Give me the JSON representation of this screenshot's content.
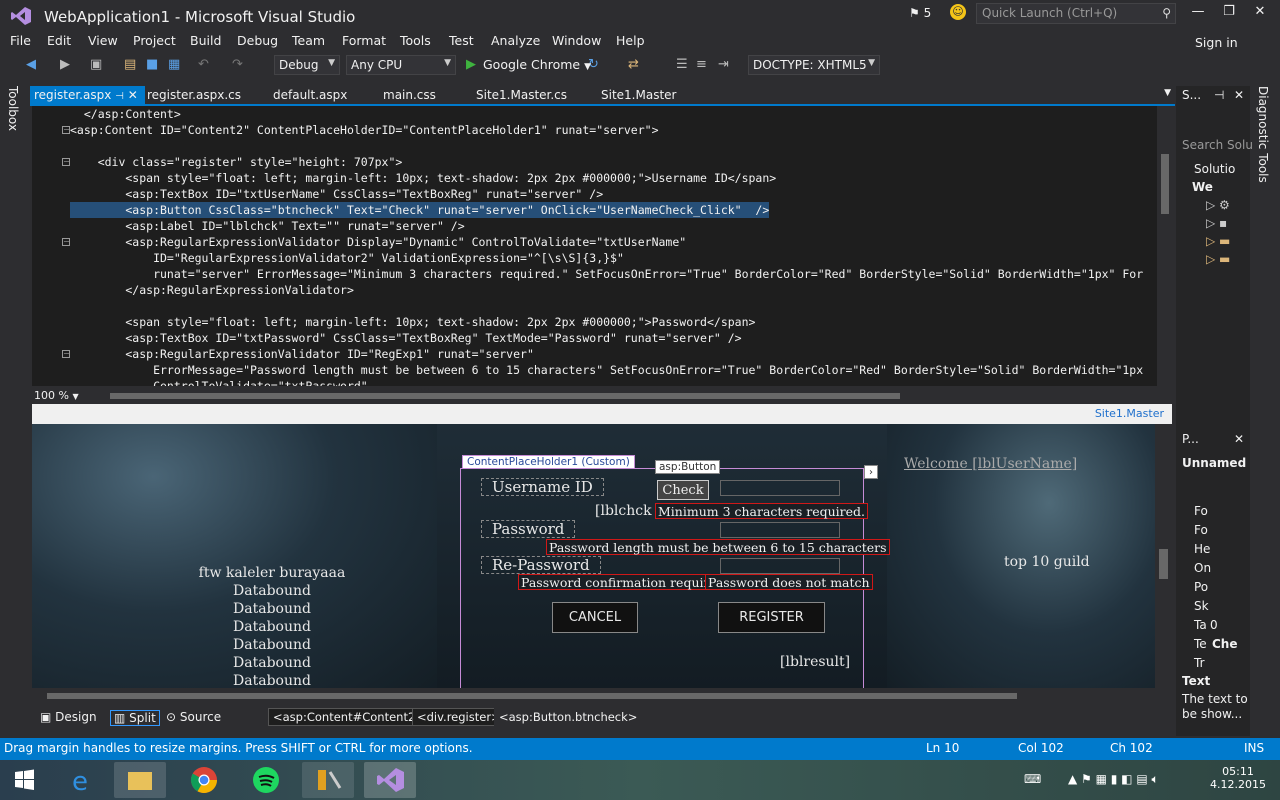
{
  "window": {
    "title": "WebApplication1 - Microsoft Visual Studio",
    "notifications": "5",
    "quick_launch_placeholder": "Quick Launch (Ctrl+Q)",
    "sign_in": "Sign in"
  },
  "menu": [
    "File",
    "Edit",
    "View",
    "Project",
    "Build",
    "Debug",
    "Team",
    "Format",
    "Tools",
    "Test",
    "Analyze",
    "Window",
    "Help"
  ],
  "toolbar": {
    "config": "Debug",
    "platform": "Any CPU",
    "browser": "Google Chrome",
    "doctype": "DOCTYPE: XHTML5"
  },
  "left_strip": "Toolbox",
  "right_strip": "Diagnostic Tools",
  "tabs": [
    "register.aspx",
    "register.aspx.cs",
    "default.aspx",
    "main.css",
    "Site1.Master.cs",
    "Site1.Master"
  ],
  "code": [
    "  </asp:Content>",
    "<asp:Content ID=\"Content2\" ContentPlaceHolderID=\"ContentPlaceHolder1\" runat=\"server\">",
    "",
    "    <div class=\"register\" style=\"height: 707px\">",
    "        <span style=\"float: left; margin-left: 10px; text-shadow: 2px 2px #000000;\">Username ID</span>",
    "        <asp:TextBox ID=\"txtUserName\" CssClass=\"TextBoxReg\" runat=\"server\" />",
    "        <asp:Button CssClass=\"btncheck\" Text=\"Check\" runat=\"server\" OnClick=\"UserNameCheck_Click\"  />",
    "        <asp:Label ID=\"lblchck\" Text=\"\" runat=\"server\" />",
    "        <asp:RegularExpressionValidator Display=\"Dynamic\" ControlToValidate=\"txtUserName\"",
    "            ID=\"RegularExpressionValidator2\" ValidationExpression=\"^[\\s\\S]{3,}$\"",
    "            runat=\"server\" ErrorMessage=\"Minimum 3 characters required.\" SetFocusOnError=\"True\" BorderColor=\"Red\" BorderStyle=\"Solid\" BorderWidth=\"1px\" For",
    "        </asp:RegularExpressionValidator>",
    "",
    "        <span style=\"float: left; margin-left: 10px; text-shadow: 2px 2px #000000;\">Password</span>",
    "        <asp:TextBox ID=\"txtPassword\" CssClass=\"TextBoxReg\" TextMode=\"Password\" runat=\"server\" />",
    "        <asp:RegularExpressionValidator ID=\"RegExp1\" runat=\"server\"",
    "            ErrorMessage=\"Password length must be between 6 to 15 characters\" SetFocusOnError=\"True\" BorderColor=\"Red\" BorderStyle=\"Solid\" BorderWidth=\"1px",
    "            ControlToValidate=\"txtPassword\""
  ],
  "zoom": "100 %",
  "master_link": "Site1.Master",
  "design": {
    "left_title": "ftw kaleler burayaaa",
    "databound": [
      "Databound",
      "Databound",
      "Databound",
      "Databound",
      "Databound",
      "Databound"
    ],
    "cph_tag": "ContentPlaceHolder1 (Custom)",
    "button_tag": "asp:Button",
    "username_label": "Username ID",
    "check": "Check",
    "lblchck": "[lblchck ]",
    "err_min": "Minimum 3 characters required.",
    "password_label": "Password",
    "err_pwlen": "Password length must be between 6 to 15 characters",
    "repassword_label": "Re-Password",
    "err_confirm": "Password confirmation required",
    "err_match": "Password does not match",
    "cancel": "CANCEL",
    "register": "REGISTER",
    "lblresult": "[lblresult]",
    "welcome": "Welcome [lblUserName]",
    "top10": "top 10 guild"
  },
  "viewbar": {
    "design": "Design",
    "split": "Split",
    "source": "Source",
    "crumbs": [
      "<asp:Content#Content2>",
      "<div.register>",
      "<asp:Button.btncheck>"
    ]
  },
  "solution": {
    "header": "S...",
    "search": "Search Solu",
    "solution": "Solutio",
    "project": "We"
  },
  "properties": {
    "header": "P...",
    "object": "Unnamed",
    "rows": [
      "Fo",
      "Fo",
      "He",
      "On",
      "Po",
      "Sk",
      "Ta",
      "Te",
      "Tr"
    ],
    "ta_val": "0",
    "te_val": "Che",
    "desc_title": "Text",
    "desc": "The text to be show..."
  },
  "status": {
    "message": "Drag margin handles to resize margins. Press SHIFT or CTRL for more options.",
    "ln": "Ln 10",
    "col": "Col 102",
    "ch": "Ch 102",
    "ins": "INS"
  },
  "clock": {
    "time": "05:11",
    "date": "4.12.2015"
  }
}
